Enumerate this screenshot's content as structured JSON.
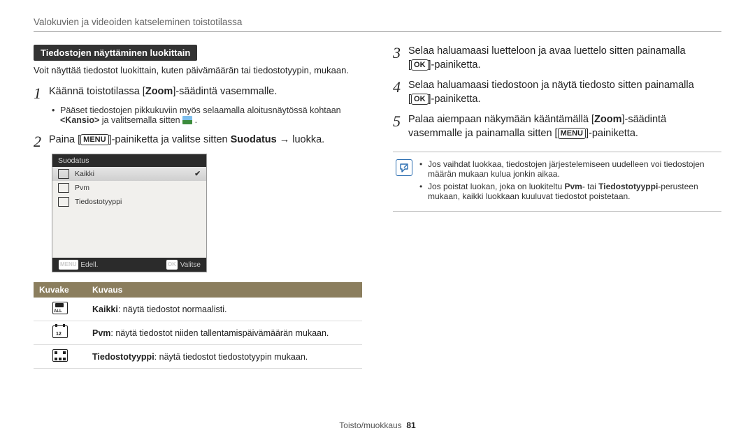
{
  "header": "Valokuvien ja videoiden katseleminen toistotilassa",
  "section_title": "Tiedostojen näyttäminen luokittain",
  "intro": "Voit näyttää tiedostot luokittain, kuten päivämäärän tai tiedostotyypin, mukaan.",
  "steps_left": {
    "s1": {
      "num": "1",
      "pre": "Käännä toistotilassa [",
      "bold": "Zoom",
      "post": "]-säädintä vasemmalle."
    },
    "s1_sub": {
      "line_a": "Pääset tiedostojen pikkukuviin myös selaamalla aloitusnäytössä kohtaan",
      "line_b_pre": "<Kansio>",
      "line_b_post": " ja valitsemalla sitten "
    },
    "s2": {
      "num": "2",
      "pre": "Paina [",
      "btn": "MENU",
      "mid": "]-painiketta ja valitse sitten ",
      "bold": "Suodatus",
      "arrow": " → ",
      "post": "luokka."
    }
  },
  "device": {
    "title": "Suodatus",
    "rows": [
      "Kaikki",
      "Pvm",
      "Tiedostotyyppi"
    ],
    "footer_left_btn": "MENU",
    "footer_left": "Edell.",
    "footer_right_btn": "OK",
    "footer_right": "Valitse"
  },
  "table": {
    "h1": "Kuvake",
    "h2": "Kuvaus",
    "r1_b": "Kaikki",
    "r1": ": näytä tiedostot normaalisti.",
    "r2_b": "Pvm",
    "r2": ": näytä tiedostot niiden tallentamispäivämäärän mukaan.",
    "r3_b": "Tiedostotyyppi",
    "r3": ": näytä tiedostot tiedostotyypin mukaan."
  },
  "steps_right": {
    "s3": {
      "num": "3",
      "line1": "Selaa haluamaasi luetteloon ja avaa luettelo sitten painamalla",
      "line2_pre": "[",
      "btn": "OK",
      "line2_post": "]-painiketta."
    },
    "s4": {
      "num": "4",
      "line1": "Selaa haluamaasi tiedostoon ja näytä tiedosto sitten painamalla",
      "line2_pre": "[",
      "btn": "OK",
      "line2_post": "]-painiketta."
    },
    "s5": {
      "num": "5",
      "line1_pre": "Palaa aiempaan näkymään kääntämällä [",
      "line1_bold": "Zoom",
      "line1_post": "]-säädintä",
      "line2_pre": "vasemmalle ja painamalla sitten [",
      "btn": "MENU",
      "line2_post": "]-painiketta."
    }
  },
  "note": {
    "b1": "Jos vaihdat luokkaa, tiedostojen järjestelemiseen uudelleen voi tiedostojen määrän mukaan kulua jonkin aikaa.",
    "b2_pre": "Jos poistat luokan, joka on luokiteltu ",
    "b2_bold1": "Pvm",
    "b2_mid": "- tai ",
    "b2_bold2": "Tiedostotyyppi",
    "b2_post": "-perusteen mukaan, kaikki luokkaan kuuluvat tiedostot poistetaan."
  },
  "footer": {
    "label": "Toisto/muokkaus",
    "page": "81"
  }
}
